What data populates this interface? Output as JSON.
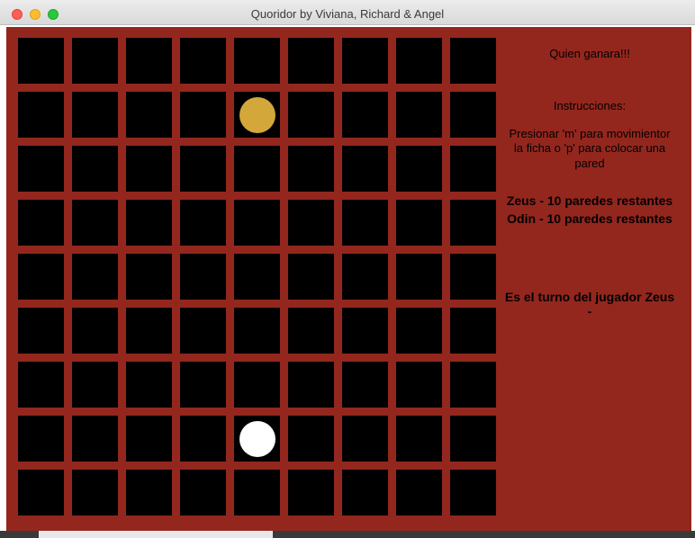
{
  "window": {
    "title": "Quoridor by Viviana, Richard & Angel"
  },
  "board": {
    "size": 9,
    "colors": {
      "background": "#93271e",
      "cell": "#000000",
      "zeus_pawn": "#d4a73b",
      "odin_pawn": "#ffffff"
    },
    "pawns": [
      {
        "player": "Zeus",
        "row": 1,
        "col": 4
      },
      {
        "player": "Odin",
        "row": 7,
        "col": 4
      }
    ]
  },
  "panel": {
    "heading": "Quien ganara!!!",
    "instructions_title": "Instrucciones:",
    "instructions_lines": [
      "Presionar 'm' para movimientor",
      "la ficha o 'p' para colocar una",
      "pared"
    ],
    "walls_zeus": "Zeus - 10 paredes restantes",
    "walls_odin": "Odin - 10 paredes restantes",
    "turn_lines": [
      "Es el turno del jugador Zeus",
      "-"
    ]
  }
}
